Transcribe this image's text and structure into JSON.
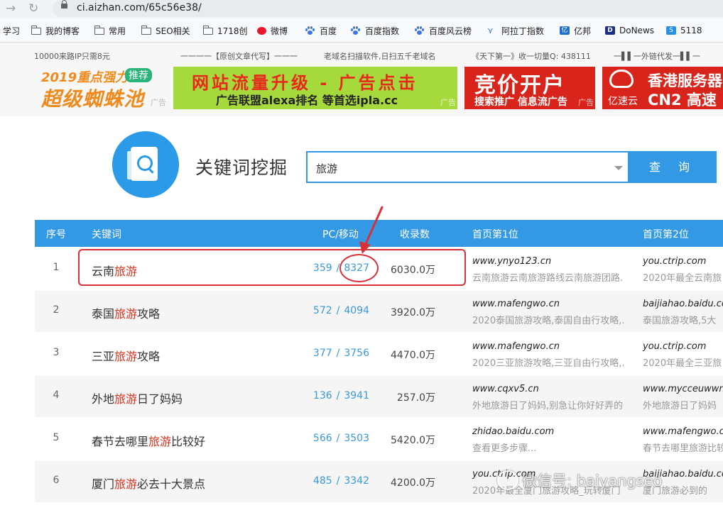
{
  "browser": {
    "url": "ci.aizhan.com/65c56e38/"
  },
  "bookmarks": [
    {
      "label": "学习",
      "icon": "folder-icon"
    },
    {
      "label": "我的博客",
      "icon": "folder-icon"
    },
    {
      "label": "常用",
      "icon": "folder-icon"
    },
    {
      "label": "SEO相关",
      "icon": "folder-icon"
    },
    {
      "label": "1718创",
      "icon": "folder-icon"
    },
    {
      "label": "微博",
      "icon": "weibo-icon"
    },
    {
      "label": "百度",
      "icon": "baidu-paw-icon"
    },
    {
      "label": "百度指数",
      "icon": "baidu-paw-icon"
    },
    {
      "label": "百度风云榜",
      "icon": "baidu-paw-icon"
    },
    {
      "label": "阿拉丁指数",
      "icon": "aladdin-icon"
    },
    {
      "label": "亿邦",
      "icon": "yibang-icon"
    },
    {
      "label": "DoNews",
      "icon": "donews-icon"
    },
    {
      "label": "5118",
      "icon": "5118-icon"
    }
  ],
  "ads": {
    "texts": [
      "10000来路IP只需8元",
      "一一一一【原创文章代写】一一一",
      "老域名扫描软件,日扫五千老域名",
      "《天下第一》收一切量Q: 438111",
      "一▌▌一外链代发一▌▌一"
    ],
    "banner1": {
      "line1": "2019重点强力",
      "tag": "推荐",
      "line2": "超级蜘蛛池",
      "ad": "广告"
    },
    "banner2": {
      "line1": "网站流量升级 - 广告点击",
      "line2": "广告联盟alexa排名 等首选ipla.cc",
      "ad": "广告"
    },
    "banner3": {
      "line1": "竞价开户",
      "line2": "搜索推广 信息流广告",
      "ad": "广告"
    },
    "banner4": {
      "brand": "亿速云",
      "line1": "香港服务器",
      "line2": "CN2 高速"
    }
  },
  "search": {
    "title": "关键词挖掘",
    "value": "旅游",
    "button": "查 询"
  },
  "table": {
    "headers": {
      "index": "序号",
      "keyword": "关键词",
      "pcm": "PC/移动",
      "count": "收录数",
      "rank1": "首页第1位",
      "rank2": "首页第2位"
    },
    "rows": [
      {
        "index": "1",
        "kw_pre": "云南",
        "kw_hl": "旅游",
        "kw_post": "",
        "pc": "359",
        "mobile": "8327",
        "count": "6030.0万",
        "r1_domain": "www.ynyo123.cn",
        "r1_title": "云南旅游云南旅游路线云南旅游团路.",
        "r2_domain": "you.ctrip.com",
        "r2_title": "2020年最全云南旅"
      },
      {
        "index": "2",
        "kw_pre": "泰国",
        "kw_hl": "旅游",
        "kw_post": "攻略",
        "pc": "572",
        "mobile": "4094",
        "count": "3920.0万",
        "r1_domain": "www.mafengwo.cn",
        "r1_title": "2020泰国旅游攻略,泰国自由行攻略,.",
        "r2_domain": "baijiahao.baidu.co",
        "r2_title": "泰国旅游攻略,5大"
      },
      {
        "index": "3",
        "kw_pre": "三亚",
        "kw_hl": "旅游",
        "kw_post": "攻略",
        "pc": "377",
        "mobile": "3756",
        "count": "4470.0万",
        "r1_domain": "www.mafengwo.cn",
        "r1_title": "2020三亚旅游攻略,三亚自由行攻略,.",
        "r2_domain": "you.ctrip.com",
        "r2_title": "2020年最全三亚旅"
      },
      {
        "index": "4",
        "kw_pre": "外地",
        "kw_hl": "旅游",
        "kw_post": "日了妈妈",
        "pc": "136",
        "mobile": "3941",
        "count": "257.0万",
        "r1_domain": "www.cqxv5.cn",
        "r1_title": "外地旅游日了妈妈,别急让你好好弄的",
        "r2_domain": "www.mycceuwwn",
        "r2_title": "外地旅游日了妈妈"
      },
      {
        "index": "5",
        "kw_pre": "春节去哪里",
        "kw_hl": "旅游",
        "kw_post": "比较好",
        "pc": "566",
        "mobile": "3503",
        "count": "5420.0万",
        "r1_domain": "zhidao.baidu.com",
        "r1_title": "查看更多步骤...",
        "r2_domain": "www.mafengwo.cn",
        "r2_title": "春节去哪里旅游比较"
      },
      {
        "index": "6",
        "kw_pre": "厦门",
        "kw_hl": "旅游",
        "kw_post": "必去十大景点",
        "pc": "485",
        "mobile": "3342",
        "count": "4200.0万",
        "r1_domain": "you.ctrip.com",
        "r1_title": "2020年最全厦门旅游攻略_玩转厦门",
        "r2_domain": "baijiahao.baidu.co",
        "r2_title": "厦门旅游必到的"
      }
    ]
  },
  "watermark": "微信号: baiyangseo",
  "colors": {
    "accent": "#3399e5",
    "highlight": "#e0301e",
    "annotation": "#d9303a"
  }
}
